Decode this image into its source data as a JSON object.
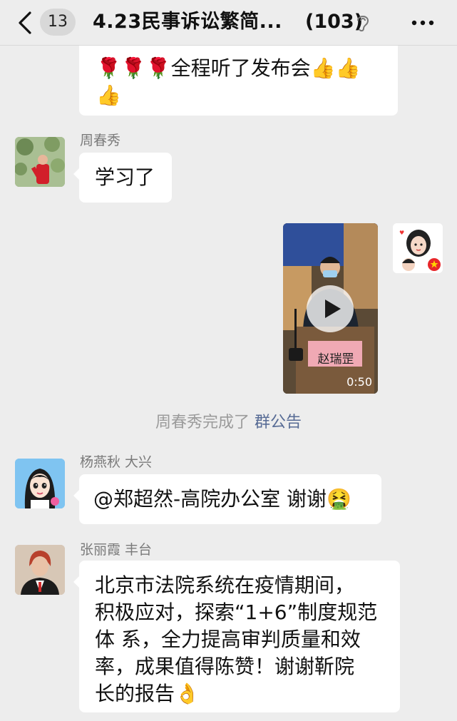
{
  "header": {
    "unread_count": "13",
    "title": "4.23民事诉讼繁简...",
    "member_count": "(103)"
  },
  "messages": {
    "m1": {
      "line1": "🌹🌹🌹全程听了发布会👍👍",
      "line2": "👍"
    },
    "m2": {
      "sender": "周春秀",
      "text": "学习了"
    },
    "m3": {
      "duration": "0:50",
      "nameplate": "赵瑞罡"
    },
    "system": {
      "actor": "周春秀完成了",
      "link": "群公告"
    },
    "m4": {
      "sender": "杨燕秋 大兴",
      "text": "@郑超然-高院办公室 谢谢🤮"
    },
    "m5": {
      "sender": "张丽霞 丰台",
      "lines": [
        "北京市法院系统在疫情期间，",
        "积极应对，探索“1+6”制度规范",
        "体 系，全力提高审判质量和效",
        "率，成果值得陈赞！谢谢靳院",
        "长的报告👌"
      ]
    }
  },
  "colors": {
    "background": "#ededed",
    "bubble": "#ffffff",
    "link": "#576b95"
  }
}
